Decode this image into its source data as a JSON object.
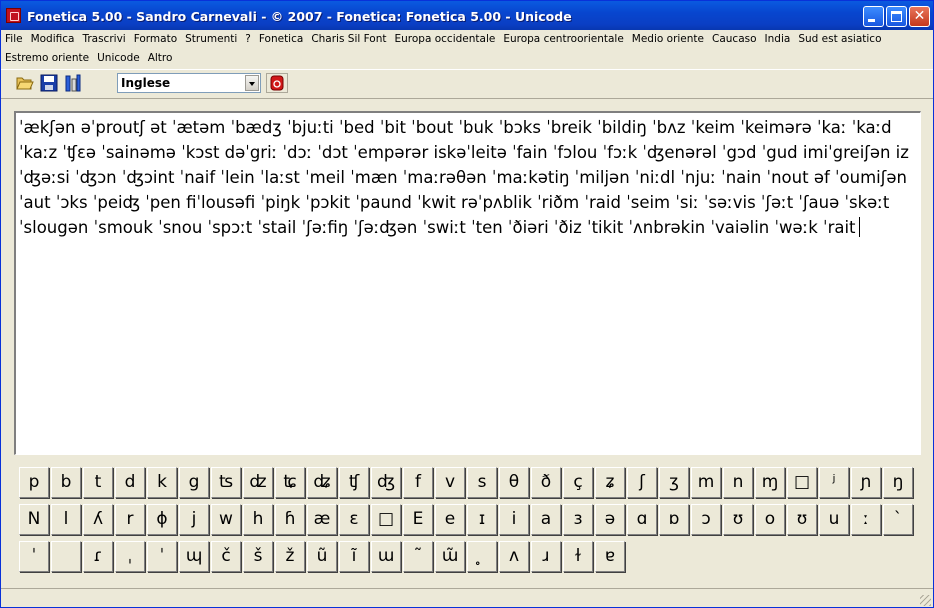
{
  "window": {
    "title": "Fonetica 5.00 - Sandro Carnevali - ©  2007 - Fonetica: Fonetica 5.00 - Unicode",
    "app_icon": "fonetica-app-icon"
  },
  "titlebar_buttons": {
    "minimize": "minimize-icon",
    "maximize": "maximize-icon",
    "close": "close-icon"
  },
  "menu": {
    "row1": [
      "File",
      "Modifica",
      "Trascrivi",
      "Formato",
      "Strumenti",
      "?",
      "Fonetica",
      "Charis Sil Font",
      "Europa occidentale",
      "Europa centroorientale",
      "Medio oriente",
      "Caucaso",
      "India",
      "Sud est asiatico"
    ],
    "row2": [
      "Estremo oriente",
      "Unicode",
      "Altro"
    ]
  },
  "toolbar": {
    "open_icon": "open-folder-icon",
    "save_icon": "save-disk-icon",
    "tool_icon": "transcription-tool-icon",
    "language_value": "Inglese",
    "red_button_icon": "red-record-icon"
  },
  "editor": {
    "text": "ˈækʃən əˈproutʃ ət ˈætəm ˈbædʒ ˈbjuːti ˈbed ˈbit ˈbout ˈbuk ˈbɔks ˈbreik ˈbildiŋ ˈbʌz ˈkeim ˈkeimərə ˈkaː ˈkaːd ˈkaːz ˈʧɛə ˈsainəmə ˈkɔst dəˈgriː ˈdɔː ˈdɔt ˈempərər iskəˈleitə ˈfain ˈfɔlou ˈfɔːk ˈʤenərəl ˈgɔd ˈgud imiˈgreiʃən iz ˈʤəːsi ˈʤɔn ˈʤɔint ˈnaif ˈlein ˈlaːst ˈmeil ˈmæn ˈmaːrəθən ˈmaːkətiŋ ˈmiljən ˈniːdl ˈnjuː ˈnain ˈnout əf ˈoumiʃən ˈaut ˈɔks ˈpeiʤ ˈpen fiˈlousəfi ˈpiŋk ˈpɔkit ˈpaund ˈkwit rəˈpʌblik ˈriðm ˈraid ˈseim ˈsiː ˈsəːvis ˈʃəːt ˈʃauə ˈskəːt ˈslougən ˈsmouk ˈsnou ˈspɔːt ˈstail ˈʃəːfiŋ ˈʃəːʤən ˈswiːt ˈten ˈðiəri ˈðiz ˈtikit ˈʌnbrəkin ˈvaiəlin ˈwəːk ˈrait"
  },
  "keyboard": {
    "row1": [
      "p",
      "b",
      "t",
      "d",
      "k",
      "g",
      "ʦ",
      "ʣ",
      "ʨ",
      "ʥ",
      "ʧ",
      "ʤ",
      "f",
      "v",
      "s",
      "θ",
      "ð",
      "ç",
      "ʑ",
      "ʃ",
      "ʒ",
      "m",
      "n",
      "ɱ",
      "□",
      "ʲ",
      "ɲ",
      "ŋ"
    ],
    "row2": [
      "N",
      "l",
      "ʎ",
      "r",
      "ɸ",
      "j",
      "w",
      "h",
      "ɦ",
      "æ",
      "ɛ",
      "□",
      "E",
      "e",
      "ɪ",
      "i",
      "a",
      "ɜ",
      "ə",
      "ɑ",
      "ɒ",
      "ɔ",
      "ʊ",
      "o",
      "ʊ",
      "u",
      "ː",
      "ˋ"
    ],
    "row3": [
      "ˈ",
      "",
      "ɾ",
      "ˌ",
      "ˈ",
      "ɰ",
      "č",
      "š",
      "ž",
      "ũ",
      "ĩ",
      "ɯ",
      "˜",
      "ɯ̃",
      "̥",
      "ʌ",
      "ɹ",
      "ɫ",
      "ɐ"
    ]
  }
}
